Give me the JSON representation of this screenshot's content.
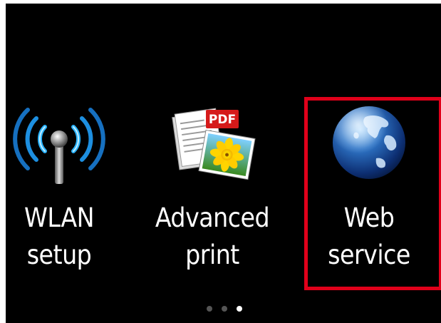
{
  "menu": {
    "items": [
      {
        "label_line1": "WLAN",
        "label_line2": "setup",
        "icon": "wifi-antenna-icon",
        "selected": false
      },
      {
        "label_line1": "Advanced",
        "label_line2": "print",
        "icon": "pdf-photo-icon",
        "selected": false,
        "icon_badge": "PDF"
      },
      {
        "label_line1": "Web",
        "label_line2": "service",
        "icon": "globe-icon",
        "selected": true
      }
    ],
    "highlight_color": "#e0001a"
  },
  "pager": {
    "pages": 3,
    "current_page": 3
  }
}
